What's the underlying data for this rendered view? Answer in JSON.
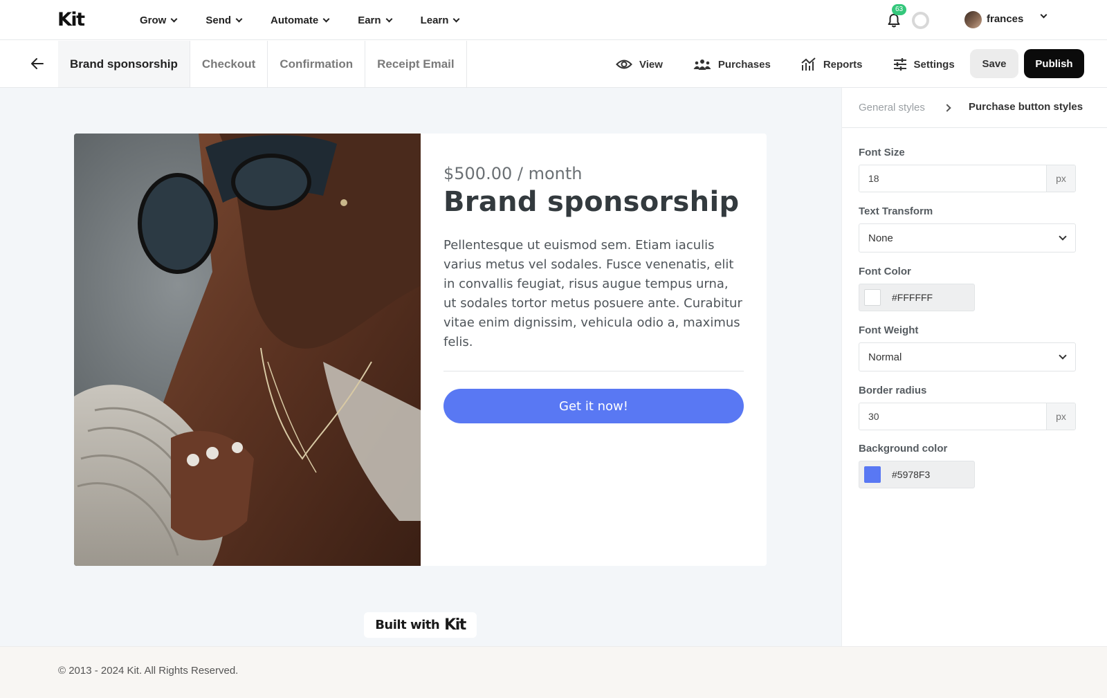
{
  "app": {
    "logo": "Kit"
  },
  "nav": {
    "items": [
      {
        "label": "Grow"
      },
      {
        "label": "Send"
      },
      {
        "label": "Automate"
      },
      {
        "label": "Earn"
      },
      {
        "label": "Learn"
      }
    ],
    "notifications_count": "63",
    "user_name": "frances"
  },
  "subnav": {
    "tabs": [
      {
        "label": "Brand sponsorship",
        "active": true
      },
      {
        "label": "Checkout"
      },
      {
        "label": "Confirmation"
      },
      {
        "label": "Receipt Email"
      }
    ],
    "actions": [
      {
        "label": "View",
        "icon": "eye-icon"
      },
      {
        "label": "Purchases",
        "icon": "people-icon"
      },
      {
        "label": "Reports",
        "icon": "chart-icon"
      },
      {
        "label": "Settings",
        "icon": "sliders-icon"
      }
    ],
    "save_label": "Save",
    "publish_label": "Publish"
  },
  "product": {
    "price": "$500.00 / month",
    "title": "Brand sponsorship",
    "description": "Pellentesque ut euismod sem. Etiam iaculis varius metus vel sodales. Fusce venenatis, elit in convallis feugiat, risus augue tempus urna, ut sodales tortor metus posuere ante. Curabitur vitae enim dignissim, vehicula odio a, maximus felis.",
    "cta_label": "Get it now!",
    "cta_color": "#5978F3"
  },
  "badge": {
    "built_with": "Built with",
    "mark": "Kit"
  },
  "panel": {
    "breadcrumb_parent": "General styles",
    "breadcrumb_current": "Purchase button styles",
    "font_size": {
      "label": "Font Size",
      "value": "18",
      "unit": "px"
    },
    "text_transform": {
      "label": "Text Transform",
      "value": "None"
    },
    "font_color": {
      "label": "Font Color",
      "value": "#FFFFFF"
    },
    "font_weight": {
      "label": "Font Weight",
      "value": "Normal"
    },
    "border_radius": {
      "label": "Border radius",
      "value": "30",
      "unit": "px"
    },
    "background_color": {
      "label": "Background color",
      "value": "#5978F3"
    }
  },
  "footer": {
    "copyright": "© 2013 - 2024 Kit. All Rights Reserved."
  },
  "colors": {
    "accent": "#5978F3",
    "publish_bg": "#0B0B0B",
    "badge_green": "#34C77B",
    "canvas_bg": "#F3F6F9"
  }
}
